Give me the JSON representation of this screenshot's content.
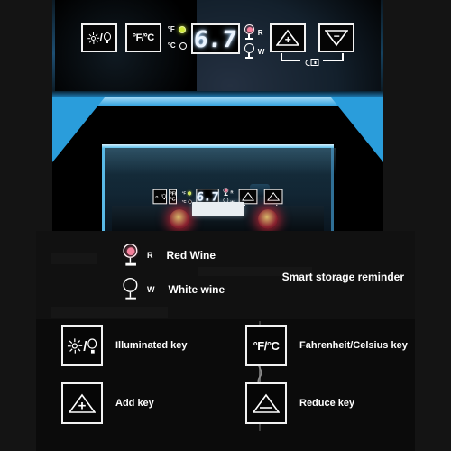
{
  "product": {
    "display_value": "6.7",
    "unit_indicators": [
      {
        "label": "°F",
        "state": "on"
      },
      {
        "label": "°C",
        "state": "off"
      }
    ],
    "wine_indicators": [
      {
        "code": "R",
        "name": "Red Wine",
        "type": "red"
      },
      {
        "code": "W",
        "name": "White wine",
        "type": "white"
      }
    ],
    "keys": [
      {
        "name": "illuminated-key",
        "glyph": "bulb",
        "label": "Illuminated key"
      },
      {
        "name": "fahrenheit-celsius-key",
        "glyph": "°F/°C",
        "label": "Fahrenheit/Celsius key"
      },
      {
        "name": "add-key",
        "glyph": "+",
        "label": "Add key"
      },
      {
        "name": "reduce-key",
        "glyph": "−",
        "label": "Reduce key"
      }
    ],
    "lock_icon": "lock-icon"
  },
  "legend": {
    "red": {
      "code": "R",
      "name": "Red Wine"
    },
    "white": {
      "code": "W",
      "name": "White wine"
    },
    "smart_note": "Smart storage reminder",
    "illuminated_label": "Illuminated key",
    "fc_label": "Fahrenheit/Celsius key",
    "add_label": "Add key",
    "reduce_label": "Reduce key",
    "fc_glyph": "°F/°C",
    "plus_glyph": "+",
    "minus_glyph": "−"
  },
  "colors": {
    "accent_blue": "#2a9ddb",
    "led_on": "#cfe83c",
    "red_wine": "#f5819c",
    "background": "#141414"
  }
}
